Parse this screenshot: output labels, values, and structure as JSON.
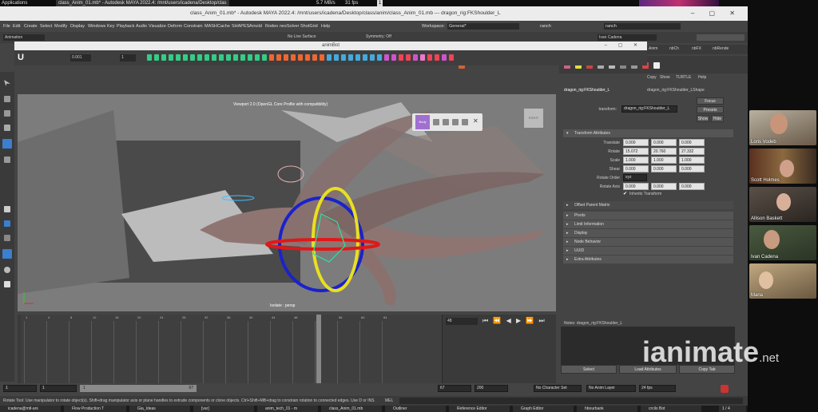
{
  "top_taskbar": {
    "applications": "Applications",
    "window_item": "class_Anim_01.mb* - Autodesk MAYA 2022.4: /mnt/users/icadena/Desktop/clas",
    "net_speed": "5.7 MB/s",
    "fps": "31 fps",
    "percent": "1"
  },
  "maya": {
    "title": "class_Anim_01.mb* - Autodesk MAYA 2022.4: /mnt/users/icadena/Desktop/class/anim/class_Anim_01.mb  ---  dragon_rig:FKShoulder_L",
    "menus": [
      "File",
      "Edit",
      "Create",
      "Select",
      "Modify",
      "Display",
      "Windows",
      "Key",
      "Playback",
      "Audio",
      "Visualize",
      "Deform",
      "Constrain",
      "MASH",
      "Cache",
      "SHAPES",
      "Arnold",
      "Rodeo",
      "nexSolver",
      "ShotGrid",
      "Help"
    ],
    "workspace_label": "Workspace:",
    "workspace_value": "General*",
    "search_value": "ranch",
    "user_value": "Ivan Cadena",
    "mode_value": "Animation",
    "no_live_surface": "No Live Surface",
    "symmetry": "Symmetry: Off",
    "side_tabs": [
      "Anim",
      "nbCh",
      "nbFX",
      "nbRende"
    ]
  },
  "animbot": {
    "title": "animBot",
    "step_value": "0.001",
    "count_value": "1",
    "logo": "U"
  },
  "viewport": {
    "title": "Viewport 2.0 (OpenGL Core Profile with compatibility)",
    "bottom_label": "Isolate : persp",
    "cube_label": "RIGHT",
    "popup_label": "Body"
  },
  "attribute_editor": {
    "menu": [
      "Copy",
      "Show",
      "TURTLE",
      "Help"
    ],
    "tabs": [
      "dragon_rig:FKShoulder_L",
      "dragon_rig:FKShoulder_LShape"
    ],
    "transform_label": "transform:",
    "transform_value": "dragon_rig:FKShoulder_L",
    "focus": "Focus",
    "presets": "Presets",
    "show": "Show",
    "hide": "Hide",
    "section_transform": "Transform Attributes",
    "rows": [
      {
        "label": "Translate",
        "values": [
          "0.000",
          "0.000",
          "0.000"
        ]
      },
      {
        "label": "Rotate",
        "values": [
          "15.072",
          "20.760",
          "27.332"
        ]
      },
      {
        "label": "Scale",
        "values": [
          "1.000",
          "1.000",
          "1.000"
        ]
      },
      {
        "label": "Shear",
        "values": [
          "0.000",
          "0.000",
          "0.000"
        ]
      }
    ],
    "rotate_order_label": "Rotate Order",
    "rotate_order_value": "xyz",
    "rotate_axis_label": "Rotate Axis",
    "rotate_axis_values": [
      "0.000",
      "0.000",
      "0.000"
    ],
    "inherits_transform": "Inherits Transform",
    "offset_parent_matrix": "Offset Parent Matrix",
    "sections": [
      "Pivots",
      "Limit Information",
      "Display",
      "Node Behavior",
      "UUID",
      "Extra Attributes"
    ],
    "notes_label": "Notes:  dragon_rig:FKShoulder_L",
    "bottom_buttons": [
      "Select",
      "Load Attributes",
      "Copy Tab"
    ]
  },
  "timeline": {
    "current_frame": "48",
    "ticks": [
      "1",
      "4",
      "8",
      "12",
      "16",
      "20",
      "24",
      "28",
      "32",
      "36",
      "40",
      "44",
      "48",
      "52",
      "56",
      "60",
      "64"
    ],
    "range_start": "1",
    "range_inner_start": "1",
    "range_inner_end": "67",
    "range_end_a": "67",
    "range_end_b": "200",
    "character_set": "No Character Set",
    "anim_layer": "No Anim Layer",
    "fps": "24 fps",
    "mel": "MEL",
    "start_field": "1"
  },
  "help_line": "Rotate Tool: Use manipulator to rotate object(s). Shift+drag manipulator axis or plane handles to extrude components or clone objects. Ctrl+Shift+MB+drag to constrain rotation to connected edges. Use D or INS",
  "bottom_taskbar": [
    "icadena@mtl-ani",
    "Flow Production T",
    "Gia_Ideas",
    "[var]",
    "anim_tech_01 - m",
    "class_Anim_01.mb",
    "Outliner",
    "Reference Editor",
    "Graph Editor",
    "hbourbank",
    "crcilo Bot",
    "1 / 4"
  ],
  "participants": [
    "Loris Vodeb",
    "Scott Holmes",
    "Allison Baskett",
    "Ivan Cadena",
    "Maria"
  ],
  "watermark": {
    "main": "ianimate",
    "suffix": ".net"
  }
}
